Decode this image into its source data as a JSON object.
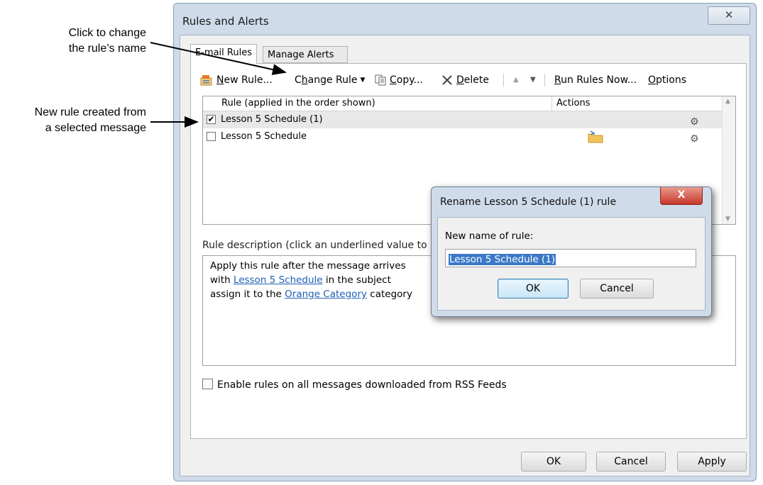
{
  "callouts": {
    "change_name": [
      "Click to change",
      "the rule’s name"
    ],
    "new_rule": [
      "New rule created from",
      "a selected message"
    ]
  },
  "dialog": {
    "title": "Rules and Alerts",
    "close_glyph": "✕",
    "tabs": [
      {
        "label": "E-mail Rules",
        "selected": true
      },
      {
        "label": "Manage Alerts",
        "selected": false
      }
    ],
    "toolbar": {
      "new_rule": {
        "underline": "N",
        "rest": "ew Rule...",
        "icon": "new-rule-icon"
      },
      "change_rule": {
        "pre": "C",
        "underline": "h",
        "rest": "ange Rule",
        "icon": "dropdown-arrow-icon"
      },
      "copy": {
        "underline": "C",
        "rest": "opy...",
        "icon": "copy-icon"
      },
      "delete": {
        "underline": "D",
        "rest": "elete",
        "icon": "delete-icon"
      },
      "run_rules": {
        "underline": "R",
        "rest": "un Rules Now..."
      },
      "options": {
        "underline": "O",
        "rest": "ptions"
      }
    },
    "list": {
      "headers": {
        "rule": "Rule (applied in the order shown)",
        "actions": "Actions"
      },
      "rows": [
        {
          "name": "Lesson 5 Schedule (1)",
          "checked": true,
          "selected": true,
          "action_icon": "",
          "end_icon": "rule-options-icon"
        },
        {
          "name": "Lesson 5 Schedule",
          "checked": false,
          "selected": false,
          "action_icon": "move-to-folder-icon",
          "end_icon": "rule-options-icon"
        }
      ]
    },
    "description": {
      "label": "Rule description (click an underlined value to",
      "line1": "Apply this rule after the message arrives",
      "line2_pre": "with ",
      "line2_link": "Lesson 5 Schedule",
      "line2_post": " in the subject",
      "line3_pre": "assign it to the ",
      "line3_link": "Orange Category",
      "line3_post": " category"
    },
    "rss_label": "Enable rules on all messages downloaded from RSS Feeds",
    "buttons": {
      "ok": "OK",
      "cancel": "Cancel",
      "apply": "Apply"
    }
  },
  "rename": {
    "title": "Rename Lesson 5 Schedule (1) rule",
    "close_glyph": "X",
    "label": "New name of rule:",
    "value": "Lesson 5 Schedule (1)",
    "ok": "OK",
    "cancel": "Cancel"
  },
  "colors": {
    "link": "#1f5fb3",
    "selection": "#3b78c7",
    "close_red": "#c8362a"
  }
}
